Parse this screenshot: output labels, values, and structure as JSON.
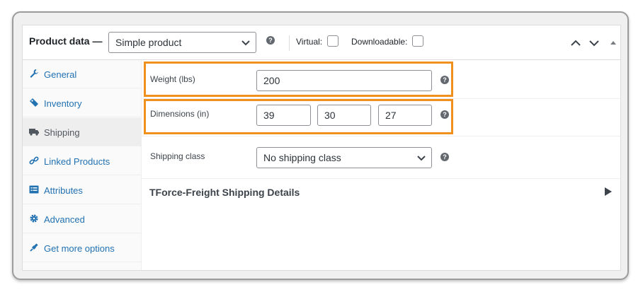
{
  "header": {
    "title": "Product data —",
    "product_type": "Simple product",
    "help_icon": "?",
    "virtual_label": "Virtual:",
    "downloadable_label": "Downloadable:"
  },
  "sidebar": {
    "items": [
      {
        "label": "General",
        "icon": "wrench-icon"
      },
      {
        "label": "Inventory",
        "icon": "tag-icon"
      },
      {
        "label": "Shipping",
        "icon": "truck-icon",
        "active": true
      },
      {
        "label": "Linked Products",
        "icon": "link-icon"
      },
      {
        "label": "Attributes",
        "icon": "list-icon"
      },
      {
        "label": "Advanced",
        "icon": "gear-icon"
      },
      {
        "label": "Get more options",
        "icon": "plugin-icon"
      }
    ]
  },
  "shipping": {
    "weight_label": "Weight (lbs)",
    "weight_value": "200",
    "dimensions_label": "Dimensions (in)",
    "length": "39",
    "width": "30",
    "height": "27",
    "class_label": "Shipping class",
    "class_value": "No shipping class",
    "tforce_title": "TForce-Freight Shipping Details"
  },
  "colors": {
    "highlight": "#f0901e",
    "link": "#2271b1"
  }
}
